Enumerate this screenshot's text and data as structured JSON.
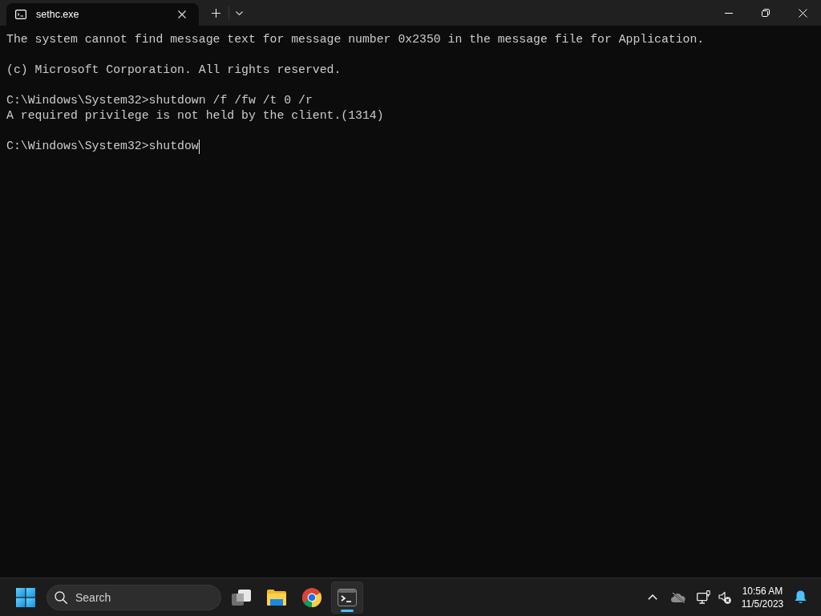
{
  "window": {
    "tabs": [
      {
        "title": "sethc.exe",
        "selected": true
      }
    ]
  },
  "console": {
    "paragraphs": [
      [
        "The system cannot find message text for message number 0x2350 in the message file for Application."
      ],
      [
        "(c) Microsoft Corporation. All rights reserved."
      ],
      [
        "C:\\Windows\\System32>shutdown /f /fw /t 0 /r",
        "A required privilege is not held by the client.(1314)"
      ],
      [
        "C:\\Windows\\System32>shutdow"
      ]
    ],
    "cursor": true
  },
  "taskbar": {
    "search": {
      "placeholder": "Search"
    },
    "apps": [
      {
        "kind": "task-view",
        "active": false
      },
      {
        "kind": "file-explorer",
        "active": false
      },
      {
        "kind": "browser",
        "active": false
      },
      {
        "kind": "terminal",
        "active": true
      }
    ],
    "clock": {
      "time": "10:56 AM",
      "date": "11/5/2023"
    }
  }
}
